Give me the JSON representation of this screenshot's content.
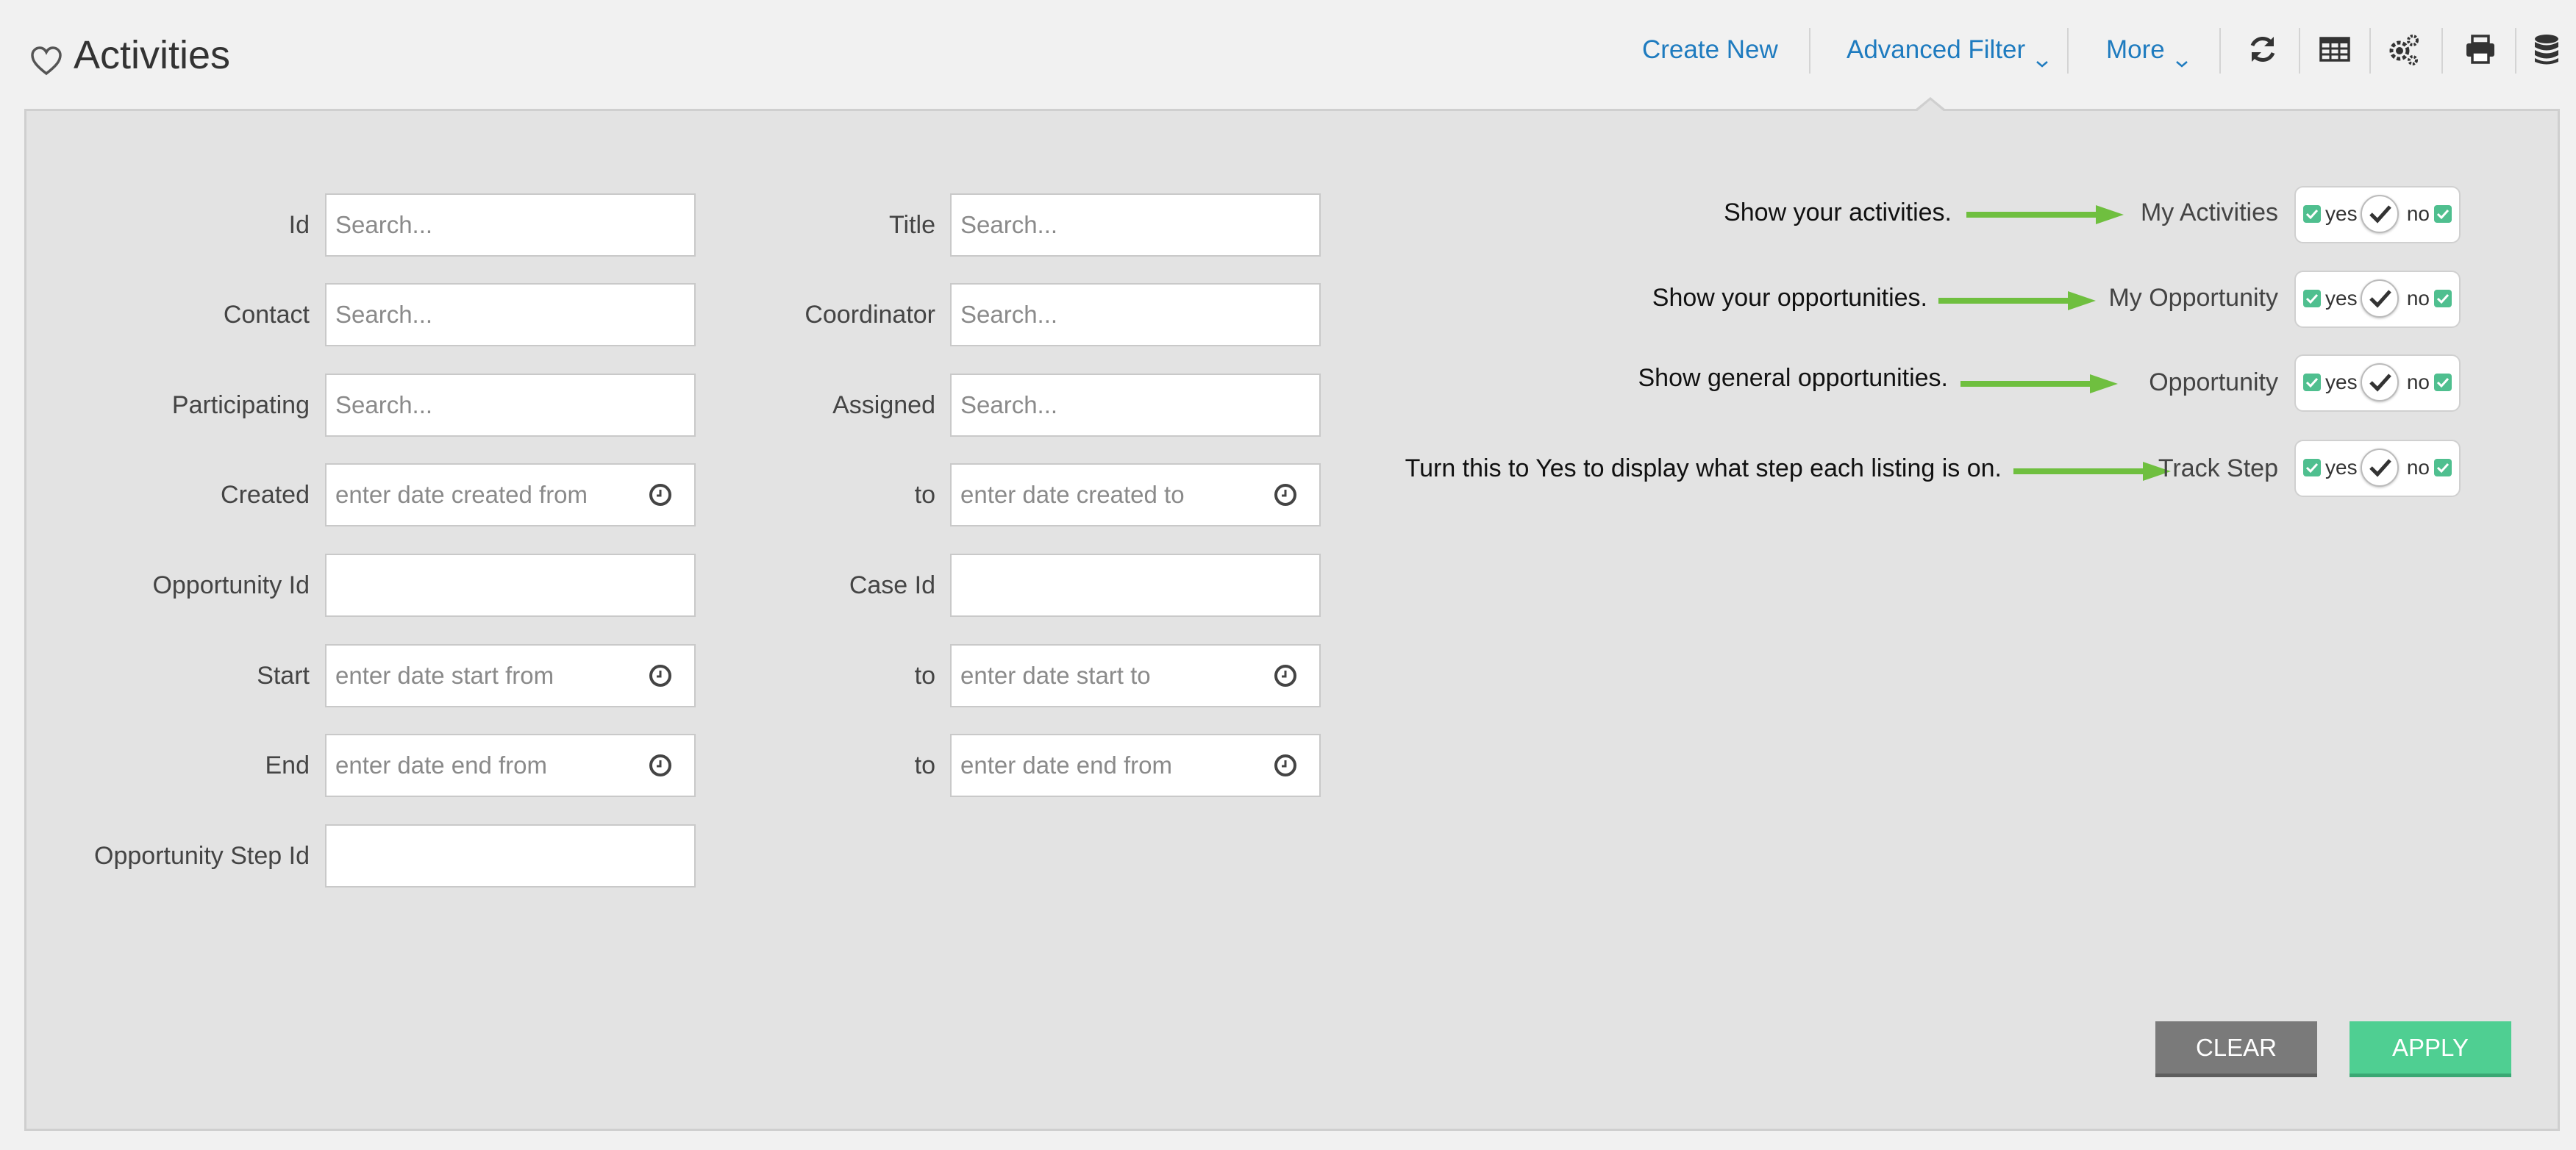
{
  "header": {
    "title": "Activities",
    "nav": {
      "create_new": "Create New",
      "advanced_filter": "Advanced Filter",
      "more": "More"
    },
    "tool_icons": [
      "refresh-icon",
      "table-icon",
      "gears-icon",
      "print-icon",
      "database-icon"
    ]
  },
  "filters": {
    "left": [
      {
        "label": "Id",
        "placeholder": "Search..."
      },
      {
        "label": "Contact",
        "placeholder": "Search..."
      },
      {
        "label": "Participating",
        "placeholder": "Search..."
      },
      {
        "label": "Created",
        "placeholder": "enter date created from"
      },
      {
        "label": "Opportunity Id",
        "placeholder": ""
      },
      {
        "label": "Start",
        "placeholder": "enter date start from"
      },
      {
        "label": "End",
        "placeholder": "enter date end from"
      },
      {
        "label": "Opportunity Step Id",
        "placeholder": ""
      }
    ],
    "middle": [
      {
        "label": "Title",
        "placeholder": "Search..."
      },
      {
        "label": "Coordinator",
        "placeholder": "Search..."
      },
      {
        "label": "Assigned",
        "placeholder": "Search..."
      },
      {
        "label": "to",
        "placeholder": "enter date created to"
      },
      {
        "label": "Case Id",
        "placeholder": ""
      },
      {
        "label": "to",
        "placeholder": "enter date start to"
      },
      {
        "label": "to",
        "placeholder": "enter date end from"
      }
    ]
  },
  "toggles": [
    {
      "annotation": "Show your activities.",
      "label": "My Activities",
      "yes": "yes",
      "no": "no"
    },
    {
      "annotation": "Show your opportunities.",
      "label": "My Opportunity",
      "yes": "yes",
      "no": "no"
    },
    {
      "annotation": "Show general opportunities.",
      "label": "Opportunity",
      "yes": "yes",
      "no": "no"
    },
    {
      "annotation": "Turn this to Yes to display what step each listing is on.",
      "label": "Track Step",
      "yes": "yes",
      "no": "no"
    }
  ],
  "buttons": {
    "clear": "CLEAR",
    "apply": "APPLY"
  },
  "colors": {
    "link": "#1e7bbf",
    "panel_bg": "#e3e3e3",
    "apply_bg": "#4fcf92",
    "clear_bg": "#7a7a7a",
    "check_green": "#4fbf8f",
    "arrow_green": "#6fbf3f"
  }
}
